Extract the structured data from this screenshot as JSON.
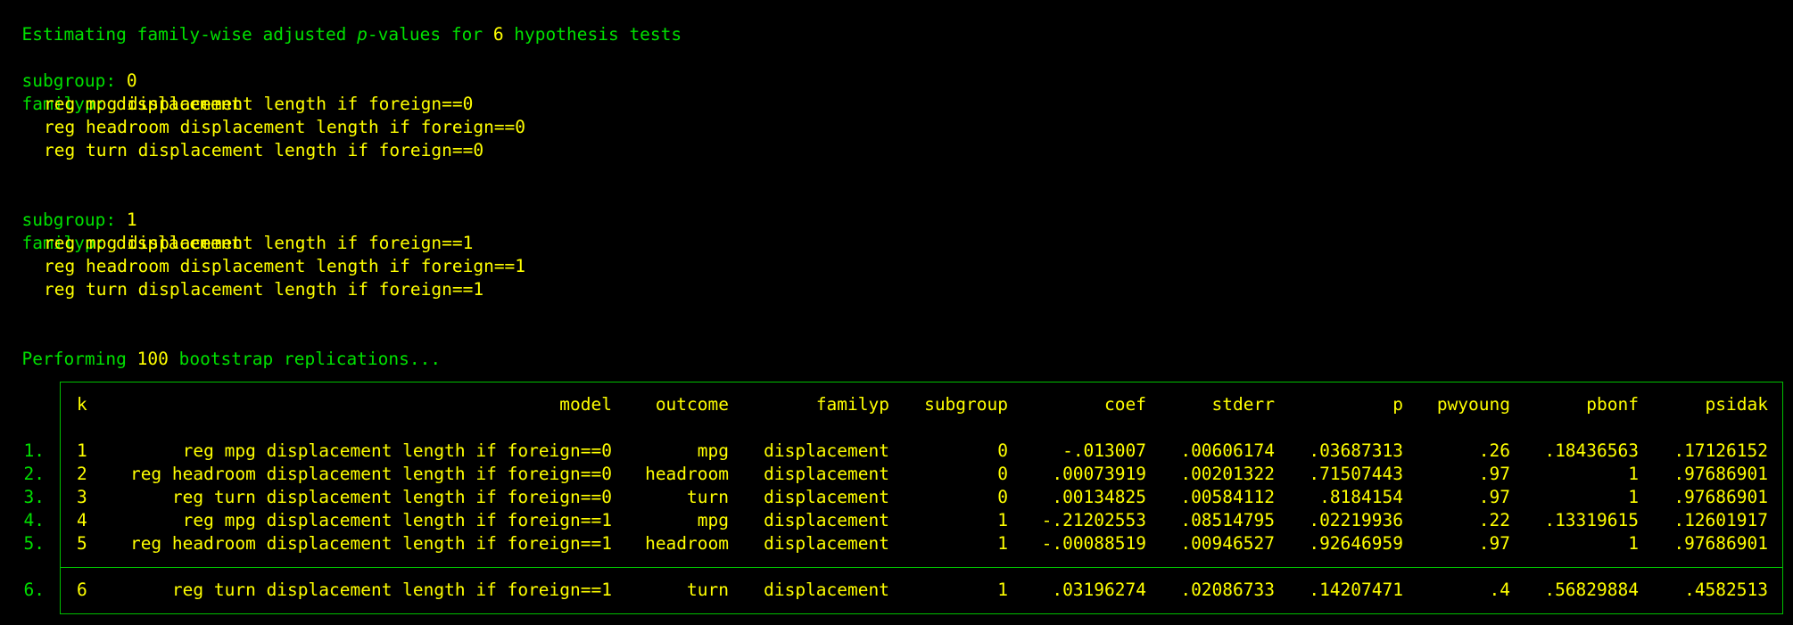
{
  "header": {
    "prefix": "Estimating family-wise adjusted ",
    "p_symbol": "p",
    "middle": "-values for ",
    "num_tests": "6",
    "suffix": " hypothesis tests"
  },
  "groups": [
    {
      "subgroup_label": "subgroup:",
      "subgroup_value": "0",
      "familyp_label": "familyp:",
      "familyp_value": "displacement",
      "commands": [
        "reg mpg displacement length if foreign==0",
        "reg headroom displacement length if foreign==0",
        "reg turn displacement length if foreign==0"
      ]
    },
    {
      "subgroup_label": "subgroup:",
      "subgroup_value": "1",
      "familyp_label": "familyp:",
      "familyp_value": "displacement",
      "commands": [
        "reg mpg displacement length if foreign==1",
        "reg headroom displacement length if foreign==1",
        "reg turn displacement length if foreign==1"
      ]
    }
  ],
  "bootstrap": {
    "prefix": "Performing ",
    "count": "100",
    "suffix": " bootstrap replications..."
  },
  "table": {
    "columns": [
      "k",
      "model",
      "outcome",
      "familyp",
      "subgroup",
      "coef",
      "stderr",
      "p",
      "pwyoung",
      "pbonf",
      "psidak"
    ],
    "rows": [
      {
        "num": "1.",
        "cells": [
          "1",
          "reg mpg displacement length if foreign==0",
          "mpg",
          "displacement",
          "0",
          "-.013007",
          ".00606174",
          ".03687313",
          ".26",
          ".18436563",
          ".17126152"
        ]
      },
      {
        "num": "2.",
        "cells": [
          "2",
          "reg headroom displacement length if foreign==0",
          "headroom",
          "displacement",
          "0",
          ".00073919",
          ".00201322",
          ".71507443",
          ".97",
          "1",
          ".97686901"
        ]
      },
      {
        "num": "3.",
        "cells": [
          "3",
          "reg turn displacement length if foreign==0",
          "turn",
          "displacement",
          "0",
          ".00134825",
          ".00584112",
          ".8184154",
          ".97",
          "1",
          ".97686901"
        ]
      },
      {
        "num": "4.",
        "cells": [
          "4",
          "reg mpg displacement length if foreign==1",
          "mpg",
          "displacement",
          "1",
          "-.21202553",
          ".08514795",
          ".02219936",
          ".22",
          ".13319615",
          ".12601917"
        ]
      },
      {
        "num": "5.",
        "cells": [
          "5",
          "reg headroom displacement length if foreign==1",
          "headroom",
          "displacement",
          "1",
          "-.00088519",
          ".00946527",
          ".92646959",
          ".97",
          "1",
          ".97686901"
        ]
      },
      {
        "num": "6.",
        "cells": [
          "6",
          "reg turn displacement length if foreign==1",
          "turn",
          "displacement",
          "1",
          ".03196274",
          ".02086733",
          ".14207471",
          ".4",
          ".56829884",
          ".4582513"
        ]
      }
    ]
  },
  "colors": {
    "background": "#000000",
    "text_green": "#00e000",
    "text_yellow": "#ffff00",
    "border": "#00c000"
  }
}
